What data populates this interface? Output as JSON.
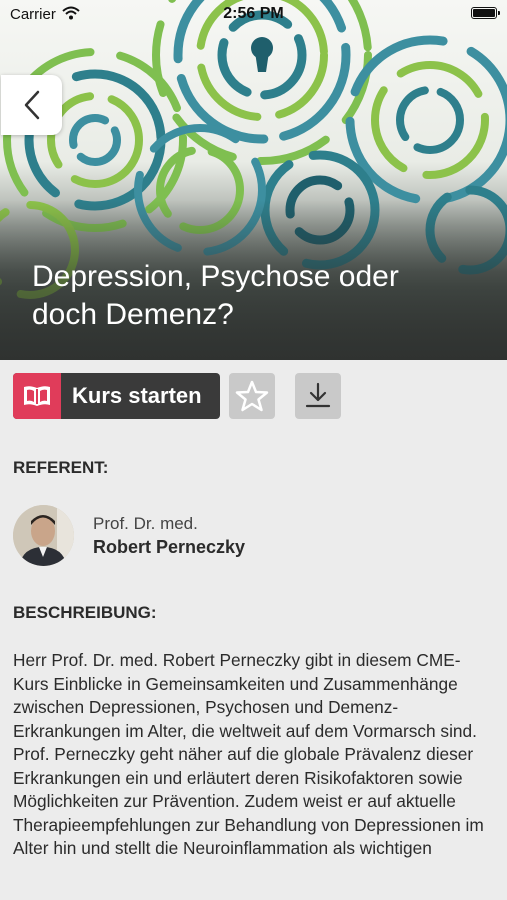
{
  "status_bar": {
    "carrier": "Carrier",
    "time": "2:56 PM"
  },
  "hero": {
    "title": "Depression, Psychose oder doch Demenz?"
  },
  "actions": {
    "start_label": "Kurs starten"
  },
  "referent": {
    "label": "REFERENT:",
    "title": "Prof. Dr. med.",
    "name": "Robert Perneczky"
  },
  "description": {
    "label": "BESCHREIBUNG:",
    "text": "Herr Prof. Dr. med. Robert Perneczky gibt in diesem CME-Kurs Einblicke in Gemeinsamkeiten und Zusammenhänge zwischen Depressionen, Psychosen und Demenz-Erkrankungen im Alter, die weltweit auf dem Vormarsch sind. Prof. Perneczky geht näher auf die globale Prävalenz dieser Erkrankungen ein und erläutert deren Risikofaktoren sowie Möglichkeiten zur Prävention. Zudem weist er auf aktuelle Therapieempfehlungen zur Behandlung von Depressionen im Alter hin und stellt die Neuroinflammation als wichtigen"
  },
  "colors": {
    "accent": "#e03c5a",
    "button_dark": "#3a3a3a",
    "button_grey": "#c9c9c9",
    "background": "#ececec"
  }
}
